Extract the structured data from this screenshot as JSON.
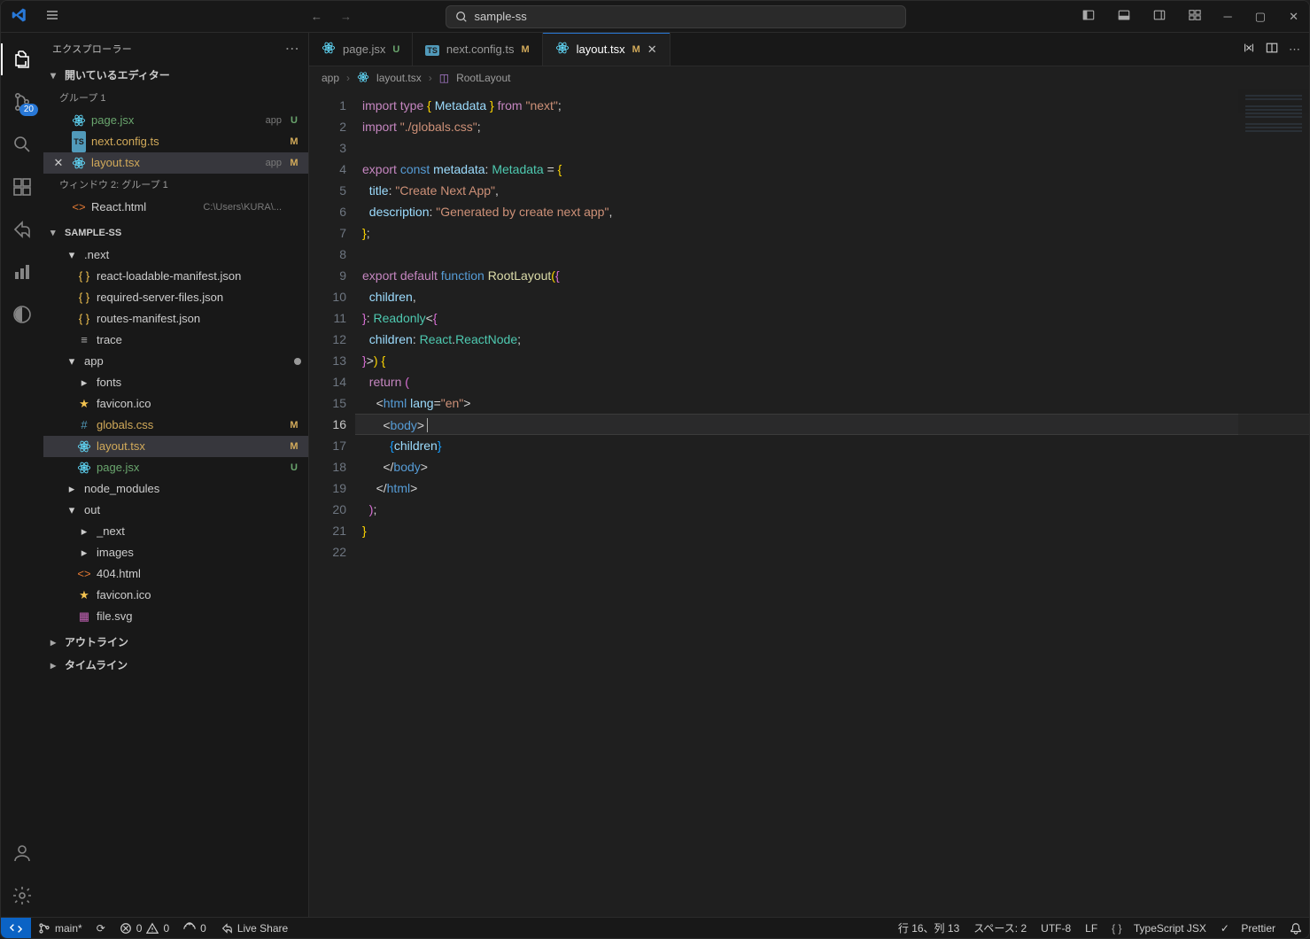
{
  "title_search": "sample-ss",
  "sidebar_title": "エクスプローラー",
  "open_editors_label": "開いているエディター",
  "group1_label": "グループ 1",
  "group2_label": "ウィンドウ 2: グループ 1",
  "outline_label": "アウトライン",
  "timeline_label": "タイムライン",
  "project_name": "SAMPLE-SS",
  "source_control_badge": "20",
  "open_editors": [
    {
      "icon": "react",
      "name": "page.jsx",
      "hint": "app",
      "status": "U"
    },
    {
      "icon": "ts",
      "name": "next.config.ts",
      "hint": "",
      "status": "M"
    },
    {
      "icon": "react",
      "name": "layout.tsx",
      "hint": "app",
      "status": "M",
      "active": true
    },
    {
      "icon": "html",
      "name": "React.html",
      "hint": "C:\\Users\\KURA\\...",
      "status": "",
      "group": 2
    }
  ],
  "files": [
    {
      "depth": 0,
      "type": "folder",
      "chev": "▾",
      "name": ".next"
    },
    {
      "depth": 1,
      "type": "json",
      "name": "react-loadable-manifest.json"
    },
    {
      "depth": 1,
      "type": "json",
      "name": "required-server-files.json"
    },
    {
      "depth": 1,
      "type": "json",
      "name": "routes-manifest.json"
    },
    {
      "depth": 1,
      "type": "file",
      "name": "trace",
      "icon": "lines"
    },
    {
      "depth": 0,
      "type": "folder",
      "chev": "▾",
      "name": "app",
      "dirty": true
    },
    {
      "depth": 1,
      "type": "folder",
      "chev": "▸",
      "name": "fonts"
    },
    {
      "depth": 1,
      "type": "star",
      "name": "favicon.ico"
    },
    {
      "depth": 1,
      "type": "css",
      "name": "globals.css",
      "status": "M"
    },
    {
      "depth": 1,
      "type": "react",
      "name": "layout.tsx",
      "status": "M",
      "sel": true
    },
    {
      "depth": 1,
      "type": "react",
      "name": "page.jsx",
      "status": "U"
    },
    {
      "depth": 0,
      "type": "folder",
      "chev": "▸",
      "name": "node_modules"
    },
    {
      "depth": 0,
      "type": "folder",
      "chev": "▾",
      "name": "out"
    },
    {
      "depth": 1,
      "type": "folder",
      "chev": "▸",
      "name": "_next"
    },
    {
      "depth": 1,
      "type": "folder",
      "chev": "▸",
      "name": "images"
    },
    {
      "depth": 1,
      "type": "html",
      "name": "404.html"
    },
    {
      "depth": 1,
      "type": "star",
      "name": "favicon.ico"
    },
    {
      "depth": 1,
      "type": "svg",
      "name": "file.svg"
    }
  ],
  "tabs": [
    {
      "icon": "react",
      "name": "page.jsx",
      "status": "U"
    },
    {
      "icon": "ts",
      "name": "next.config.ts",
      "status": "M"
    },
    {
      "icon": "react",
      "name": "layout.tsx",
      "status": "M",
      "active": true,
      "close": true
    }
  ],
  "breadcrumb": [
    "app",
    "layout.tsx",
    "RootLayout"
  ],
  "code_lines": [
    [
      {
        "c": "tok-kw",
        "t": "import"
      },
      {
        "t": " "
      },
      {
        "c": "tok-kw",
        "t": "type"
      },
      {
        "t": " "
      },
      {
        "c": "tok-brk",
        "t": "{"
      },
      {
        "t": " "
      },
      {
        "c": "tok-var",
        "t": "Metadata"
      },
      {
        "t": " "
      },
      {
        "c": "tok-brk",
        "t": "}"
      },
      {
        "t": " "
      },
      {
        "c": "tok-kw",
        "t": "from"
      },
      {
        "t": " "
      },
      {
        "c": "tok-str",
        "t": "\"next\""
      },
      {
        "c": "tok-pun",
        "t": ";"
      }
    ],
    [
      {
        "c": "tok-kw",
        "t": "import"
      },
      {
        "t": " "
      },
      {
        "c": "tok-str",
        "t": "\"./globals.css\""
      },
      {
        "c": "tok-pun",
        "t": ";"
      }
    ],
    [],
    [
      {
        "c": "tok-kw",
        "t": "export"
      },
      {
        "t": " "
      },
      {
        "c": "tok-kw2",
        "t": "const"
      },
      {
        "t": " "
      },
      {
        "c": "tok-var",
        "t": "metadata"
      },
      {
        "c": "tok-pun",
        "t": ": "
      },
      {
        "c": "tok-type",
        "t": "Metadata"
      },
      {
        "t": " "
      },
      {
        "c": "tok-pun",
        "t": "= "
      },
      {
        "c": "tok-brk",
        "t": "{"
      }
    ],
    [
      {
        "t": "  "
      },
      {
        "c": "tok-var",
        "t": "title"
      },
      {
        "c": "tok-pun",
        "t": ": "
      },
      {
        "c": "tok-str",
        "t": "\"Create Next App\""
      },
      {
        "c": "tok-pun",
        "t": ","
      }
    ],
    [
      {
        "t": "  "
      },
      {
        "c": "tok-var",
        "t": "description"
      },
      {
        "c": "tok-pun",
        "t": ": "
      },
      {
        "c": "tok-str",
        "t": "\"Generated by create next app\""
      },
      {
        "c": "tok-pun",
        "t": ","
      }
    ],
    [
      {
        "c": "tok-brk",
        "t": "}"
      },
      {
        "c": "tok-pun",
        "t": ";"
      }
    ],
    [],
    [
      {
        "c": "tok-kw",
        "t": "export"
      },
      {
        "t": " "
      },
      {
        "c": "tok-kw",
        "t": "default"
      },
      {
        "t": " "
      },
      {
        "c": "tok-kw2",
        "t": "function"
      },
      {
        "t": " "
      },
      {
        "c": "tok-fn",
        "t": "RootLayout"
      },
      {
        "c": "tok-brk",
        "t": "("
      },
      {
        "c": "tok-brk2",
        "t": "{"
      }
    ],
    [
      {
        "t": "  "
      },
      {
        "c": "tok-var",
        "t": "children"
      },
      {
        "c": "tok-pun",
        "t": ","
      }
    ],
    [
      {
        "c": "tok-brk2",
        "t": "}"
      },
      {
        "c": "tok-pun",
        "t": ": "
      },
      {
        "c": "tok-type",
        "t": "Readonly"
      },
      {
        "c": "tok-pun",
        "t": "<"
      },
      {
        "c": "tok-brk2",
        "t": "{"
      }
    ],
    [
      {
        "t": "  "
      },
      {
        "c": "tok-var",
        "t": "children"
      },
      {
        "c": "tok-pun",
        "t": ": "
      },
      {
        "c": "tok-type",
        "t": "React"
      },
      {
        "c": "tok-pun",
        "t": "."
      },
      {
        "c": "tok-type",
        "t": "ReactNode"
      },
      {
        "c": "tok-pun",
        "t": ";"
      }
    ],
    [
      {
        "c": "tok-brk2",
        "t": "}"
      },
      {
        "c": "tok-pun",
        "t": ">"
      },
      {
        "c": "tok-brk",
        "t": ")"
      },
      {
        "t": " "
      },
      {
        "c": "tok-brk",
        "t": "{"
      }
    ],
    [
      {
        "t": "  "
      },
      {
        "c": "tok-kw",
        "t": "return"
      },
      {
        "t": " "
      },
      {
        "c": "tok-brk2",
        "t": "("
      }
    ],
    [
      {
        "t": "    "
      },
      {
        "c": "tok-pun",
        "t": "<"
      },
      {
        "c": "tok-tag",
        "t": "html"
      },
      {
        "t": " "
      },
      {
        "c": "tok-var",
        "t": "lang"
      },
      {
        "c": "tok-pun",
        "t": "="
      },
      {
        "c": "tok-str",
        "t": "\"en\""
      },
      {
        "c": "tok-pun",
        "t": ">"
      }
    ],
    [
      {
        "t": "      "
      },
      {
        "c": "tok-pun",
        "t": "<"
      },
      {
        "c": "tok-tag",
        "t": "body"
      },
      {
        "c": "tok-pun",
        "t": ">"
      },
      {
        "c": "cursor",
        "t": " "
      }
    ],
    [
      {
        "t": "        "
      },
      {
        "c": "tok-brk3",
        "t": "{"
      },
      {
        "c": "tok-var",
        "t": "children"
      },
      {
        "c": "tok-brk3",
        "t": "}"
      }
    ],
    [
      {
        "t": "      "
      },
      {
        "c": "tok-pun",
        "t": "</"
      },
      {
        "c": "tok-tag",
        "t": "body"
      },
      {
        "c": "tok-pun",
        "t": ">"
      }
    ],
    [
      {
        "t": "    "
      },
      {
        "c": "tok-pun",
        "t": "</"
      },
      {
        "c": "tok-tag",
        "t": "html"
      },
      {
        "c": "tok-pun",
        "t": ">"
      }
    ],
    [
      {
        "t": "  "
      },
      {
        "c": "tok-brk2",
        "t": ")"
      },
      {
        "c": "tok-pun",
        "t": ";"
      }
    ],
    [
      {
        "c": "tok-brk",
        "t": "}"
      }
    ],
    []
  ],
  "current_line": 16,
  "status": {
    "branch": "main*",
    "sync": "⟳",
    "errors_label": "0",
    "warnings_label": "0",
    "ports": "0",
    "liveshare": "Live Share",
    "cursor": "行 16、列 13",
    "spaces": "スペース: 2",
    "encoding": "UTF-8",
    "eol": "LF",
    "lang": "TypeScript JSX",
    "prettier": "Prettier"
  }
}
